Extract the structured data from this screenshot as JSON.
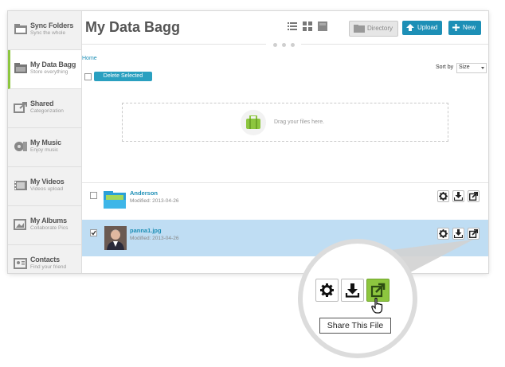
{
  "sidebar": {
    "items": [
      {
        "label": "Sync Folders",
        "sub": "Sync the whole",
        "icon": "sync-folders-icon",
        "active": false
      },
      {
        "label": "My Data Bagg",
        "sub": "Store everything",
        "icon": "folder-icon",
        "active": true
      },
      {
        "label": "Shared",
        "sub": "Categorization",
        "icon": "share-icon",
        "active": false
      },
      {
        "label": "My Music",
        "sub": "Enjoy music",
        "icon": "music-icon",
        "active": false
      },
      {
        "label": "My Videos",
        "sub": "Videos upload",
        "icon": "video-icon",
        "active": false
      },
      {
        "label": "My Albums",
        "sub": "Collaborate Pics",
        "icon": "album-icon",
        "active": false
      },
      {
        "label": "Contacts",
        "sub": "Find your friend",
        "icon": "contacts-icon",
        "active": false
      }
    ]
  },
  "header": {
    "title": "My Data Bagg",
    "directory_label": "Directory",
    "upload_label": "Upload",
    "new_label": "New"
  },
  "toolbar": {
    "breadcrumb": "Home",
    "delete_label": "Delete Selected",
    "sort_label": "Sort by",
    "sort_value": "Size"
  },
  "dropzone": {
    "text": "Drag your files here."
  },
  "files": [
    {
      "name": "Anderson",
      "modified": "Modified: 2013-04-26",
      "type": "folder",
      "checked": false
    },
    {
      "name": "panna1.jpg",
      "modified": "Modified: 2013-04-26",
      "type": "image",
      "checked": true
    }
  ],
  "callout": {
    "tooltip": "Share This File"
  },
  "colors": {
    "accent": "#1d8fb6",
    "active_green": "#8dc63f",
    "selected_row": "#bfddf3"
  }
}
